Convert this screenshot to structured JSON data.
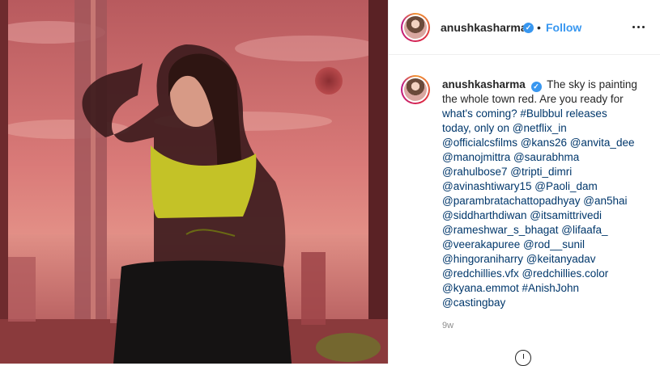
{
  "post": {
    "photo_icon": "portrait-photo",
    "header": {
      "username": "anushkasharma",
      "verified_icon": "verified-badge-icon",
      "separator": "•",
      "follow_label": "Follow",
      "more_icon": "more-options-icon"
    },
    "caption": {
      "username": "anushkasharma",
      "lines": [
        "The sky is painting",
        "the whole town red. Are you ready for",
        "what's coming? #Bulbbul releases",
        "today, only on @netflix_in",
        "@officialcsfilms @kans26 @anvita_dee",
        "@manojmittra @saurabhma",
        "@rahulbose7 @tripti_dimri",
        "@avinashtiwary15 @Paoli_dam",
        "@parambratachattopadhyay @an5hai",
        "@siddharthdiwan @itsamittrivedi",
        "@rameshwar_s_bhagat @lifaafa_",
        "@veerakapuree @rod__sunil",
        "@hingoraniharry @keitanyadav",
        "@redchillies.vfx @redchillies.color",
        "@kyana.emmot #AnishJohn",
        "@castingbay"
      ]
    },
    "time_ago": "9w",
    "colors": {
      "accent": "#3897f0",
      "link": "#00376b",
      "text": "#262626",
      "muted": "#8e8e8e"
    }
  }
}
